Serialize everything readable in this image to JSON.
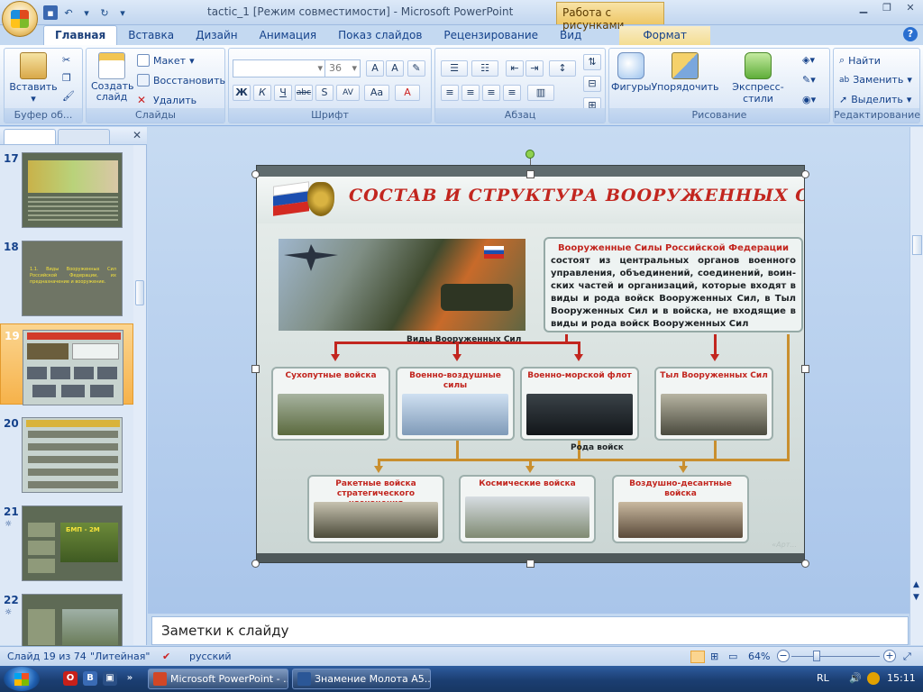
{
  "window": {
    "title": "tactic_1 [Режим совместимости] - Microsoft PowerPoint",
    "context_tab": "Работа с рисунками"
  },
  "tabs": [
    "Главная",
    "Вставка",
    "Дизайн",
    "Анимация",
    "Показ слайдов",
    "Рецензирование",
    "Вид",
    "Формат"
  ],
  "ribbon": {
    "paste": "Вставить",
    "clipboard_group": "Буфер об...",
    "new_slide": "Создать слайд",
    "layout": "Макет",
    "reset": "Восстановить",
    "delete": "Удалить",
    "slides_group": "Слайды",
    "font_size": "36",
    "font_group": "Шрифт",
    "paragraph_group": "Абзац",
    "shapes": "Фигуры",
    "arrange": "Упорядочить",
    "quick_styles": "Экспресс-стили",
    "drawing_group": "Рисование",
    "find": "Найти",
    "replace": "Заменить",
    "select": "Выделить",
    "editing_group": "Редактирование"
  },
  "thumbnails": [
    {
      "num": "17",
      "star": "",
      "text": ""
    },
    {
      "num": "18",
      "star": "",
      "text": "1.1. Виды Вооруженных Сил Российской Федерации, их предназначение и вооружение."
    },
    {
      "num": "19",
      "star": "",
      "text": ""
    },
    {
      "num": "20",
      "star": "",
      "text": ""
    },
    {
      "num": "21",
      "star": "☼",
      "text": "БМП - 2М"
    },
    {
      "num": "22",
      "star": "☼",
      "text": ""
    }
  ],
  "slide": {
    "title": "СОСТАВ И СТРУКТУРА ВООРУЖЕННЫХ СИЛ",
    "desc_lead": "Вооруженные Силы Российской Федерации",
    "desc_body": "состоят из центральных органов военного управления, объединений, соединений, воин-ских частей и организаций, которые входят в виды и рода войск Вооруженных Сил, в Тыл Вооруженных Сил и в войска, не входящие в виды и рода войск Вооруженных Сил",
    "types_caption": "Виды Вооруженных Сил",
    "branches_caption": "Рода войск",
    "cards_top": [
      "Сухопутные войска",
      "Военно-воздушные силы",
      "Военно-морской флот",
      "Тыл Вооруженных Сил"
    ],
    "cards_bottom": [
      "Ракетные войска стратегического назначения",
      "Космические войска",
      "Воздушно-десантные войска"
    ],
    "footer_mark": "«Арт..."
  },
  "notes_placeholder": "Заметки к слайду",
  "status": {
    "slide_pos": "Слайд 19 из 74",
    "theme": "\"Литейная\"",
    "language": "русский",
    "zoom": "64%"
  },
  "taskbar": {
    "btn1": "Microsoft PowerPoint - ...",
    "btn2": "Знамение Молота A5...",
    "lang": "RL",
    "clock": "15:11"
  }
}
